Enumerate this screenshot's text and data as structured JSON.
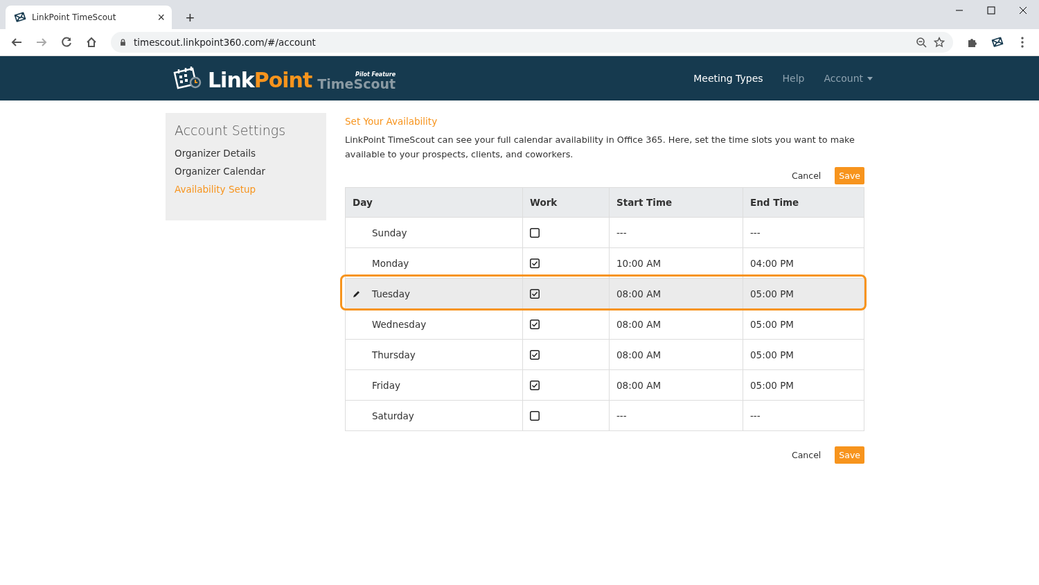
{
  "browser": {
    "tab_title": "LinkPoint TimeScout",
    "close_tab": "×",
    "new_tab": "+",
    "url": "timescout.linkpoint360.com/#/account"
  },
  "header": {
    "logo_link": "Link",
    "logo_point": "Point",
    "logo_product": "TimeScout",
    "logo_badge": "Pilot Feature",
    "nav": [
      {
        "label": "Meeting Types",
        "selected": true,
        "dropdown": false
      },
      {
        "label": "Help",
        "selected": false,
        "dropdown": false
      },
      {
        "label": "Account",
        "selected": false,
        "dropdown": true
      }
    ]
  },
  "sidebar": {
    "title": "Account Settings",
    "items": [
      {
        "label": "Organizer Details",
        "selected": false
      },
      {
        "label": "Organizer Calendar",
        "selected": false
      },
      {
        "label": "Availability Setup",
        "selected": true
      }
    ]
  },
  "main": {
    "title": "Set Your Availability",
    "description": "LinkPoint TimeScout can see your full calendar availability in Office 365. Here, set the time slots you want to make available to your prospects, clients, and coworkers.",
    "top_buttons": {
      "cancel": "Cancel",
      "save": "Save"
    },
    "table": {
      "columns": [
        "Day",
        "Work",
        "Start Time",
        "End Time"
      ],
      "rows": [
        {
          "day": "Sunday",
          "work": false,
          "start": "---",
          "end": "---",
          "selected": false
        },
        {
          "day": "Monday",
          "work": true,
          "start": "10:00 AM",
          "end": "04:00 PM",
          "selected": false
        },
        {
          "day": "Tuesday",
          "work": true,
          "start": "08:00 AM",
          "end": "05:00 PM",
          "selected": true
        },
        {
          "day": "Wednesday",
          "work": true,
          "start": "08:00 AM",
          "end": "05:00 PM",
          "selected": false
        },
        {
          "day": "Thursday",
          "work": true,
          "start": "08:00 AM",
          "end": "05:00 PM",
          "selected": false
        },
        {
          "day": "Friday",
          "work": true,
          "start": "08:00 AM",
          "end": "05:00 PM",
          "selected": false
        },
        {
          "day": "Saturday",
          "work": false,
          "start": "---",
          "end": "---",
          "selected": false
        }
      ]
    },
    "bottom_buttons": {
      "cancel": "Cancel",
      "save": "Save"
    }
  }
}
